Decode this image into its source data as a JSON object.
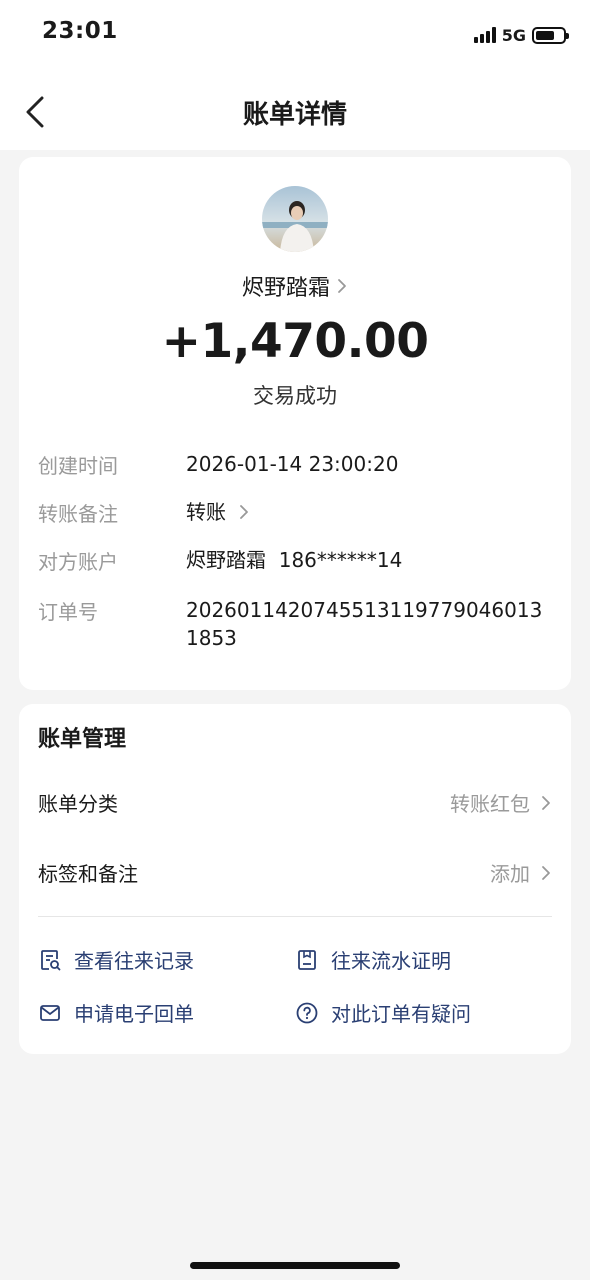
{
  "status_bar": {
    "time": "23:01",
    "network": "5G",
    "battery_level": 0.7
  },
  "nav": {
    "title": "账单详情"
  },
  "transaction": {
    "payer_name": "烬野踏霜",
    "amount": "+1,470.00",
    "status": "交易成功",
    "details": [
      {
        "label": "创建时间",
        "value": "2026-01-14 23:00:20"
      },
      {
        "label": "转账备注",
        "value": "转账"
      },
      {
        "label": "对方账户",
        "value": "烬野踏霜  186******14"
      },
      {
        "label": "订单号",
        "value": "2026011420745513119779046013 1853"
      }
    ]
  },
  "manage": {
    "title": "账单管理",
    "rows": [
      {
        "label": "账单分类",
        "value": "转账红包"
      },
      {
        "label": "标签和备注",
        "value": "添加"
      }
    ],
    "actions": [
      {
        "label": "查看往来记录",
        "icon": "records-icon"
      },
      {
        "label": "往来流水证明",
        "icon": "statement-icon"
      },
      {
        "label": "申请电子回单",
        "icon": "envelope-icon"
      },
      {
        "label": "对此订单有疑问",
        "icon": "question-icon"
      }
    ]
  },
  "colors": {
    "accent": "#2a3f73",
    "muted": "#9a9a9a",
    "background": "#f4f4f4"
  }
}
